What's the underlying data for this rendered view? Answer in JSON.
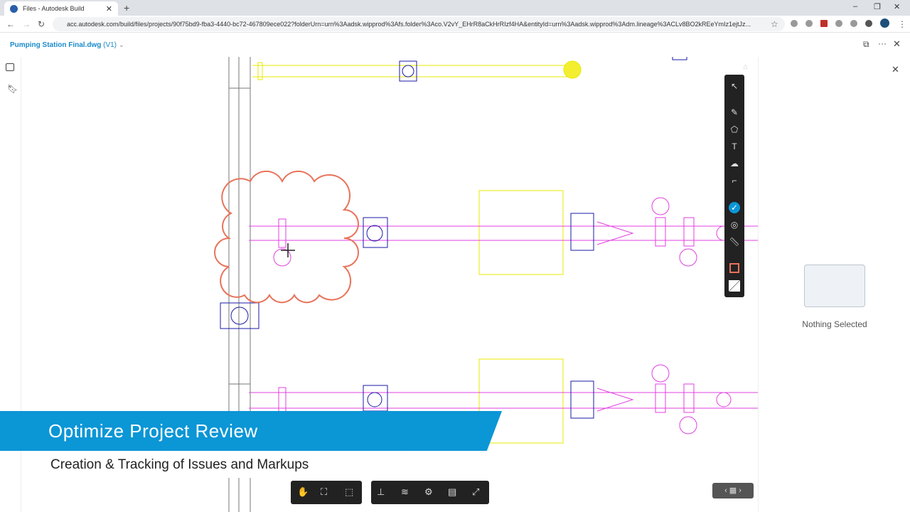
{
  "browser": {
    "tab_title": "Files - Autodesk Build",
    "url": "acc.autodesk.com/build/files/projects/90f75bd9-fba3-4440-bc72-467809ece022?folderUrn=urn%3Aadsk.wipprod%3Afs.folder%3Aco.V2vY_EHrR8aCkHrRIzf4HA&entityId=urn%3Aadsk.wipprod%3Adm.lineage%3ACLv8BO2kREeYmIz1ejtJz..."
  },
  "header": {
    "file_name": "Pumping Station Final.dwg",
    "version": "(V1)"
  },
  "right_panel": {
    "empty_text": "Nothing Selected"
  },
  "banner": {
    "title": "Optimize Project Review",
    "subtitle": "Creation & Tracking of Issues and Markups"
  },
  "colors": {
    "accent": "#0b96d6",
    "markup": "#e8735a",
    "pipe": "#e040e0",
    "equipment": "#1a1aa8"
  }
}
